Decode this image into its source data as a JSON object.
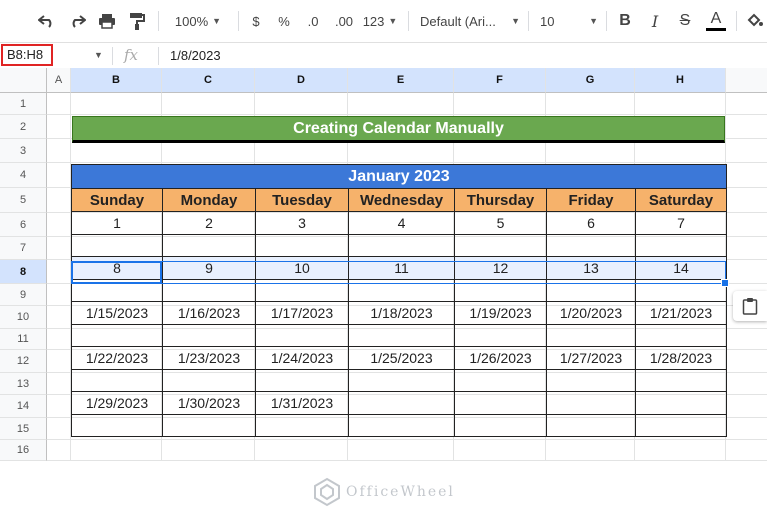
{
  "toolbar": {
    "zoom": "100%",
    "currency": "$",
    "percent": "%",
    "decrease_decimals": ".0",
    "increase_decimals": ".00",
    "more_formats": "123",
    "font": "Default (Ari...",
    "font_size": "10",
    "bold": "B",
    "italic": "I",
    "strike": "S",
    "text_color": "A",
    "text_color_value": "#000000"
  },
  "formula_bar": {
    "name_box": "B8:H8",
    "fx": "fx",
    "value": "1/8/2023"
  },
  "columns": [
    "A",
    "B",
    "C",
    "D",
    "E",
    "F",
    "G",
    "H"
  ],
  "rows": [
    "1",
    "2",
    "3",
    "4",
    "5",
    "6",
    "7",
    "8",
    "9",
    "10",
    "11",
    "12",
    "13",
    "14",
    "15",
    "16"
  ],
  "sheet": {
    "banner": "Creating Calendar Manually",
    "month": "January 2023",
    "days": [
      "Sunday",
      "Monday",
      "Tuesday",
      "Wednesday",
      "Thursday",
      "Friday",
      "Saturday"
    ],
    "week1": [
      "1",
      "2",
      "3",
      "4",
      "5",
      "6",
      "7"
    ],
    "week2": [
      "8",
      "9",
      "10",
      "11",
      "12",
      "13",
      "14"
    ],
    "week3": [
      "1/15/2023",
      "1/16/2023",
      "1/17/2023",
      "1/18/2023",
      "1/19/2023",
      "1/20/2023",
      "1/21/2023"
    ],
    "week4": [
      "1/22/2023",
      "1/23/2023",
      "1/24/2023",
      "1/25/2023",
      "1/26/2023",
      "1/27/2023",
      "1/28/2023"
    ],
    "week5": [
      "1/29/2023",
      "1/30/2023",
      "1/31/2023",
      "",
      "",
      "",
      ""
    ]
  },
  "watermark": "OfficeWheel",
  "colors": {
    "banner_green": "#6aa84f",
    "month_blue": "#3c78d8",
    "day_orange": "#f6b26b",
    "selection_blue": "#1a73e8",
    "namebox_border": "#e02424"
  }
}
